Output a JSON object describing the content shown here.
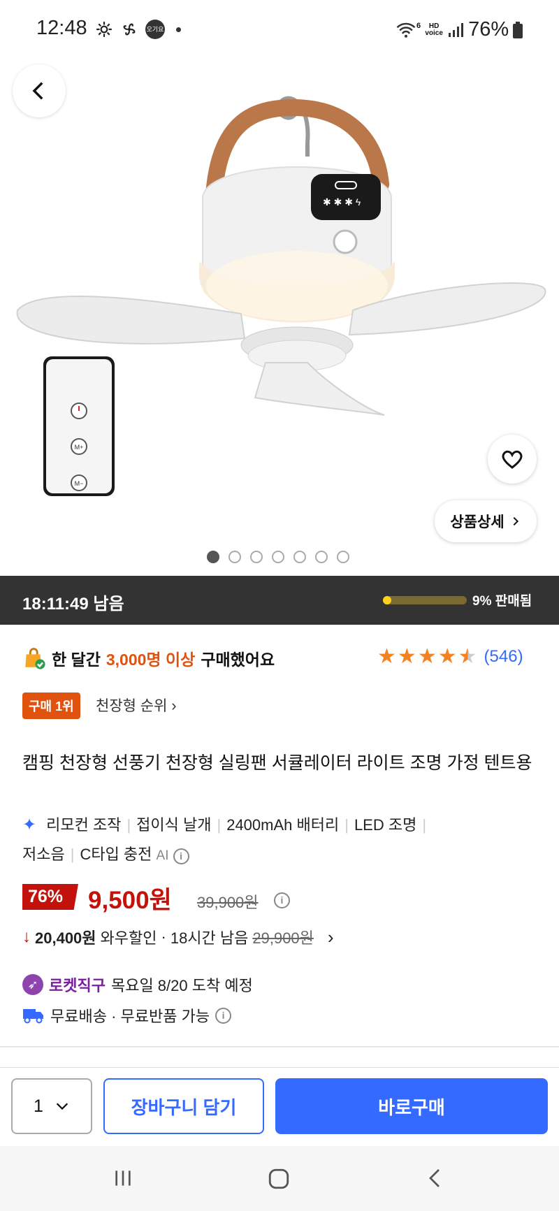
{
  "status_bar": {
    "time": "12:48",
    "icons": [
      "gear-icon",
      "fan-icon",
      "app-badge-icon",
      "dot-icon"
    ],
    "app_badge_text": "오기요",
    "network_label": "HD voice",
    "wifi_number": "6",
    "battery": "76%"
  },
  "hero": {
    "image_dots": 7,
    "active_dot": 0,
    "detail_button_label": "상품상세",
    "remote_buttons": [
      "M+",
      "M−"
    ]
  },
  "timer": {
    "remaining": "18:11:49 남음",
    "sold_label": "9% 판매됨",
    "sold_fraction": 0.09
  },
  "purchase": {
    "prefix": "한 달간",
    "highlight": "3,000명 이상",
    "suffix": "구매했어요"
  },
  "rating": {
    "stars": 4.5,
    "count": "(546)"
  },
  "rank": {
    "badge": "구매 1위",
    "link": "천장형 순위"
  },
  "product": {
    "title": "캠핑 천장형 선풍기 천장형 실링팬 서큘레이터 라이트 조명 가정 텐트용",
    "features": [
      "리모컨 조작",
      "접이식 날개",
      "2400mAh 배터리",
      "LED 조명",
      "저소음",
      "C타입 충전"
    ],
    "ai_label": "AI"
  },
  "price": {
    "discount": "76%",
    "sale": "9,500원",
    "original": "39,900원"
  },
  "wow": {
    "amount": "20,400원",
    "label": "와우할인",
    "time_left": "18시간 남음",
    "original": "29,900원"
  },
  "delivery": {
    "rocket_label": "로켓직구",
    "arrival": "목요일 8/20 도착 예정",
    "free_text": "무료배송 · 무료반품 가능"
  },
  "actions": {
    "quantity": "1",
    "cart_label": "장바구니 담기",
    "buy_label": "바로구매"
  },
  "colors": {
    "accent_blue": "#346aff",
    "price_red": "#c2120b",
    "orange": "#e0530f",
    "star": "#f58220",
    "timer_bg": "#333333",
    "sold_fill": "#ffd21e"
  }
}
